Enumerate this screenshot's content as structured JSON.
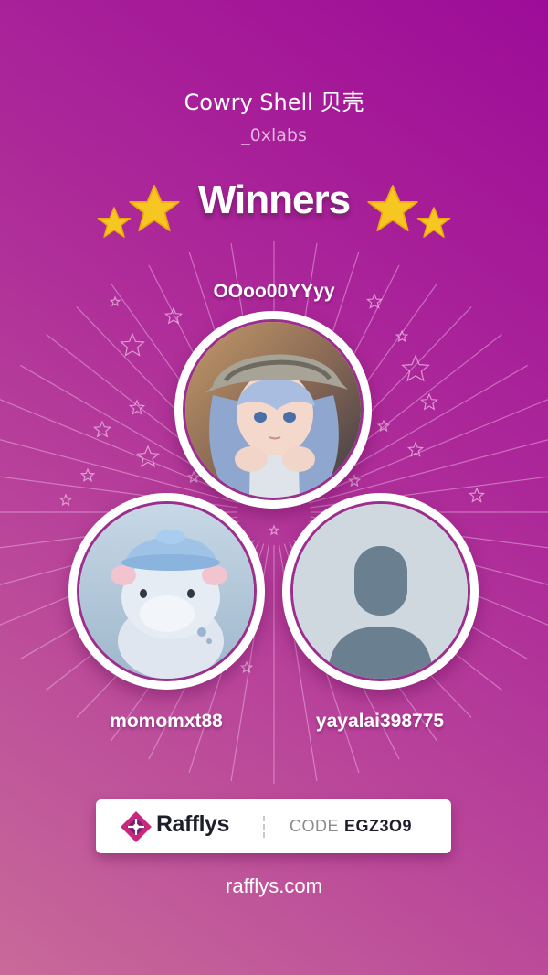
{
  "header": {
    "title": "Cowry Shell 贝壳",
    "subtitle": "_0xlabs"
  },
  "headline": "Winners",
  "winners": [
    {
      "name": "OOoo00YYyy",
      "avatar": "anime-girl-avatar"
    },
    {
      "name": "momomxt88",
      "avatar": "hippo-avatar"
    },
    {
      "name": "yayalai398775",
      "avatar": "default-user-avatar"
    }
  ],
  "badge": {
    "brand": "Rafflys",
    "code_label": "CODE",
    "code_value": "EGZ3O9"
  },
  "footer": {
    "link": "rafflys.com"
  },
  "colors": {
    "background_top": "#9d0c98",
    "background_bottom": "#c86a99",
    "star": "#f6c623",
    "ring_accent": "#9c2e8d",
    "brand_logo": "#c8287e"
  }
}
